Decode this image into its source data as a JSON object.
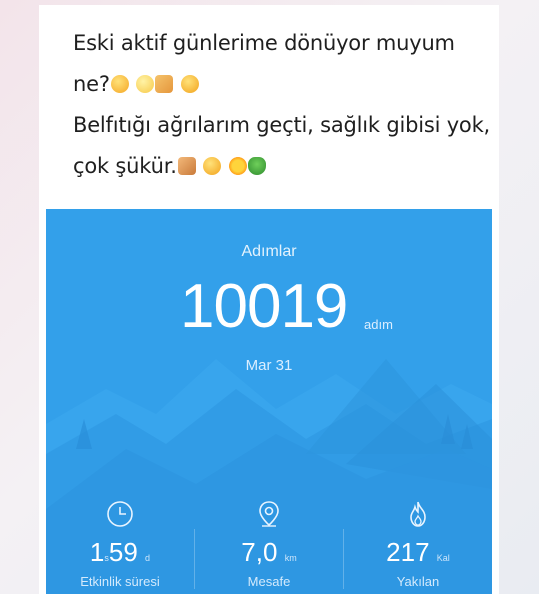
{
  "post": {
    "line1": "Eski aktif günlerime dönüyor muyum",
    "line2": "ne?",
    "line3": "Belfıtığı ağrılarım geçti, sağlık gibisi yok,",
    "line4": "çok şükür."
  },
  "activity": {
    "title": "Adımlar",
    "steps": "10019",
    "steps_unit": "adım",
    "date": "Mar 31",
    "stats": [
      {
        "icon": "clock-icon",
        "value_main": "1",
        "unit_a": "s",
        "value_sub": "59",
        "unit_b": "d",
        "label": "Etkinlik süresi"
      },
      {
        "icon": "location-pin-icon",
        "value_main": "7,0",
        "unit_a": "km",
        "label": "Mesafe"
      },
      {
        "icon": "flame-icon",
        "value_main": "217",
        "unit_a": "Kal",
        "label": "Yakılan"
      }
    ]
  },
  "colors": {
    "card_blue": "#33a0ea",
    "text": "#1f1f1f"
  }
}
